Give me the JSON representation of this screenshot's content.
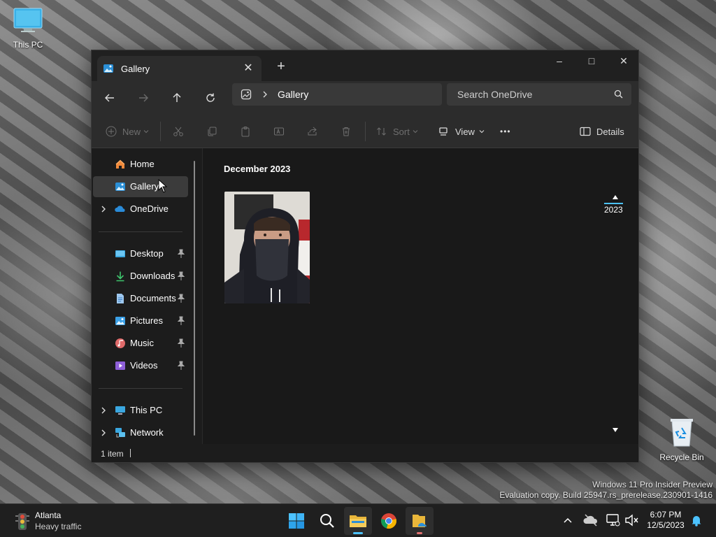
{
  "desktop": {
    "this_pc_label": "This PC",
    "recycle_bin_label": "Recycle Bin",
    "watermark_line1": "Windows 11 Pro Insider Preview",
    "watermark_line2": "Evaluation copy. Build 25947.rs_prerelease.230901-1416"
  },
  "window": {
    "tab_title": "Gallery",
    "new_tab_symbol": "+",
    "controls": {
      "minimize": "–",
      "maximize": "□",
      "close": "✕"
    },
    "address": {
      "crumb": "Gallery"
    },
    "search_placeholder": "Search OneDrive",
    "commands": {
      "new": "New",
      "sort": "Sort",
      "view": "View",
      "more": "•••",
      "details": "Details"
    },
    "sidebar": {
      "home": "Home",
      "gallery": "Gallery",
      "onedrive": "OneDrive",
      "desktop": "Desktop",
      "downloads": "Downloads",
      "documents": "Documents",
      "pictures": "Pictures",
      "music": "Music",
      "videos": "Videos",
      "this_pc": "This PC",
      "network": "Network"
    },
    "content": {
      "group_header": "December 2023",
      "timeline_year": "2023"
    },
    "status_text": "1 item"
  },
  "taskbar": {
    "weather_title": "Atlanta",
    "weather_subtitle": "Heavy traffic",
    "time": "6:07 PM",
    "date": "12/5/2023"
  },
  "colors": {
    "accent": "#4cc2ff",
    "window_bg": "#1c1c1c",
    "selected": "#3b3b3b"
  }
}
